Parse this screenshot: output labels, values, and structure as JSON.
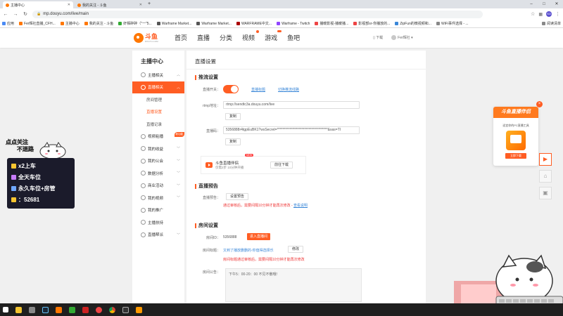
{
  "browser": {
    "tabs": [
      {
        "label": "主播中心"
      },
      {
        "label": "我的关注 - 斗鱼"
      }
    ],
    "url": "mp.douyu.com/live/main",
    "bookmarks": [
      "应用",
      "Fer辉社直播_CFH...",
      "主播中心",
      "我的关注 - 斗鱼",
      "奸相碎碎（\"一\"5...",
      "Warframe Market...",
      "Warframe Market...",
      "WARFRAME中文...",
      "Warframe - Twitch",
      "播暖影视-播暖播...",
      "影视部sr-你播放的...",
      "ZipFun的微视频和...",
      "WiFi事件选择 - ...",
      "阅读清单"
    ]
  },
  "site": {
    "logo_text": "斗鱼",
    "logo_sub": "DOUYU.COM",
    "nav": [
      {
        "label": "首页"
      },
      {
        "label": "直播"
      },
      {
        "label": "分类"
      },
      {
        "label": "视频"
      },
      {
        "label": "游戏"
      },
      {
        "label": "鱼吧"
      }
    ],
    "download_label": "下载",
    "user_label": "Fer辉社"
  },
  "sidebar": {
    "title": "主播中心",
    "items": [
      {
        "label": "主播相关"
      },
      {
        "label": "直播相关"
      },
      {
        "label": "房间管理"
      },
      {
        "label": "直播设置"
      },
      {
        "label": "直播记录"
      },
      {
        "label": "视频粘播",
        "badge": "新功能"
      },
      {
        "label": "我的收益"
      },
      {
        "label": "我的公会"
      },
      {
        "label": "数据分析"
      },
      {
        "label": "商业活动"
      },
      {
        "label": "我的视频"
      },
      {
        "label": "我的推广"
      },
      {
        "label": "主播扶持"
      },
      {
        "label": "直播帮派"
      }
    ]
  },
  "main": {
    "title": "直播设置",
    "stream": {
      "heading": "推流设置",
      "switch_label": "直播开关：",
      "switch_on": true,
      "link_rename": "直播标题",
      "link_switch": "切换推流线路",
      "rtmp_label": "rtmp地址：",
      "rtmp_value": "rtmp://sendtc3a.douyu.com/live",
      "copy_label": "复制",
      "code_label": "直播码：",
      "code_value": "5356888r4tgpEuBK1?wsSecret=*************************************&sas=TI",
      "copy2_label": "复制"
    },
    "companion": {
      "title": "斗鱼直播伴侣",
      "new_badge": "NEW",
      "subtitle": "仅需2步 10分钟开播",
      "button": "前往下载"
    },
    "notice": {
      "heading": "直播预告",
      "label": "直播预告：",
      "button": "设置预告",
      "warning": "通过审核后，需要间隔10分钟才能再次修改",
      "warning_link": "查看说明"
    },
    "room": {
      "heading": "房间设置",
      "id_label": "房间ID：",
      "id_value": "5356888",
      "enter_button": "进入直播间",
      "title_label": "房间标题：",
      "title_value": "又到了播放删删的-你值得选择乐",
      "modify_button": "修改",
      "title_warning": "房间标题通过审核后，需要间隔10分钟才能再次修改",
      "announce_label": "房间公告：",
      "announce_value": "下午5：00-20：00 不见不散哦!"
    }
  },
  "promo": {
    "title": "斗鱼直播伴侣",
    "subtitle": "适宜你的PC直播工具",
    "button": "立即下载"
  },
  "overlay": {
    "follow_1": "点点关注",
    "follow_2": "不迷路",
    "rows": [
      "x2上车",
      "全天车位",
      "永久车位+房管",
      "：52681"
    ],
    "row_colors": [
      "#f7c531",
      "#c77cff",
      "#6fa8ff",
      "#f7c531"
    ]
  }
}
